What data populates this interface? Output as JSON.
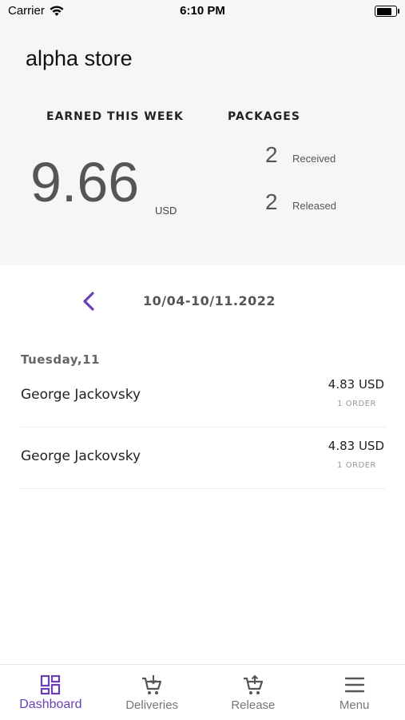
{
  "status_bar": {
    "carrier": "Carrier",
    "time": "6:10 PM",
    "battery_level": 0.9
  },
  "header": {
    "store_name": "alpha store",
    "earned_label": "EARNED THIS WEEK",
    "earned_amount": "9.66",
    "earned_currency": "USD",
    "packages_label": "PACKAGES",
    "received_count": "2",
    "received_label": "Received",
    "released_count": "2",
    "released_label": "Released"
  },
  "week": {
    "range": "10/04-10/11.2022",
    "prev_icon": "chevron-left-icon"
  },
  "day": {
    "label": "Tuesday,11"
  },
  "orders": [
    {
      "name": "George Jackovsky",
      "amount": "4.83 USD",
      "count": "1 ORDER"
    },
    {
      "name": "George Jackovsky",
      "amount": "4.83 USD",
      "count": "1 ORDER"
    }
  ],
  "tabs": [
    {
      "label": "Dashboard",
      "icon": "dashboard-icon",
      "active": true
    },
    {
      "label": "Deliveries",
      "icon": "cart-icon",
      "active": false
    },
    {
      "label": "Release",
      "icon": "cart-icon",
      "active": false
    },
    {
      "label": "Menu",
      "icon": "hamburger-icon",
      "active": false
    }
  ],
  "colors": {
    "accent": "#6a3fb5",
    "header_bg": "#f6f6f6",
    "tab_inactive": "#777777"
  }
}
